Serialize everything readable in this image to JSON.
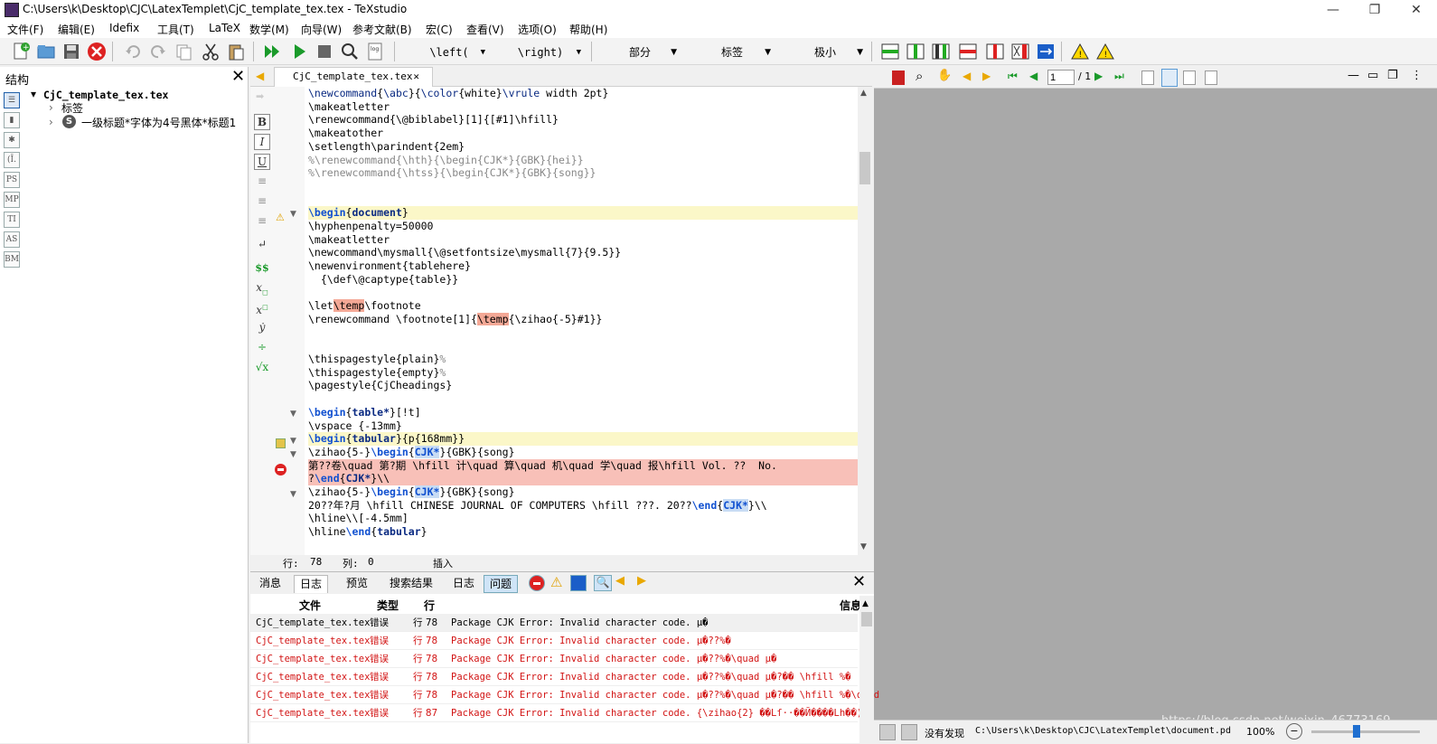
{
  "window": {
    "title": "C:\\Users\\k\\Desktop\\CJC\\LatexTemplet\\CjC_template_tex.tex - TeXstudio",
    "minimize": "—",
    "maximize": "❐",
    "close": "✕"
  },
  "menu": [
    "文件(F)",
    "编辑(E)",
    "Idefix",
    "工具(T)",
    "LaTeX",
    "数学(M)",
    "向导(W)",
    "参考文献(B)",
    "宏(C)",
    "查看(V)",
    "选项(O)",
    "帮助(H)"
  ],
  "toolbar": {
    "combo_left": "\\left(",
    "combo_right": "\\right)",
    "combo_section": "部分",
    "combo_label": "标签",
    "combo_size": "极小"
  },
  "structure": {
    "title": "结构",
    "close": "✕",
    "root": "CjC_template_tex.tex",
    "child1": "标签",
    "child2": "一级标题*字体为4号黑体*标题1",
    "side_icons": [
      "(Ī.",
      "PS",
      "MP",
      "TI",
      "AS",
      "BM"
    ]
  },
  "editor": {
    "tab_label": "CjC_template_tex.tex",
    "tab_close": "✕",
    "status_line": "行:",
    "status_line_val": "78",
    "status_col": "列:",
    "status_col_val": "0",
    "status_mode": "插入"
  },
  "code_lines": [
    "\\newcommand{\\abc}{\\color{white}\\vrule width 2pt}",
    "\\makeatletter",
    "\\renewcommand{\\@biblabel}[1]{[#1]\\hfill}",
    "\\makeatother",
    "\\setlength\\parindent{2em}",
    "%\\renewcommand{\\hth}{\\begin{CJK*}{GBK}{hei}}",
    "%\\renewcommand{\\htss}{\\begin{CJK*}{GBK}{song}}",
    "",
    "",
    "\\begin{document}",
    "\\hyphenpenalty=50000",
    "\\makeatletter",
    "\\newcommand\\mysmall{\\@setfontsize\\mysmall{7}{9.5}}",
    "\\newenvironment{tablehere}",
    "  {\\def\\@captype{table}}",
    "",
    "\\let\\temp\\footnote",
    "\\renewcommand \\footnote[1]{\\temp{\\zihao{-5}#1}}",
    "",
    "",
    "\\thispagestyle{plain}%",
    "\\thispagestyle{empty}%",
    "\\pagestyle{CjCheadings}",
    "",
    "\\begin{table*}[!t]",
    "\\vspace {-13mm}",
    "\\begin{tabular}{p{168mm}}",
    "\\zihao{5-}\\begin{CJK*}{GBK}{song}",
    "第??卷\\quad 第?期 \\hfill 计\\quad 算\\quad 机\\quad 学\\quad 报\\hfill Vol. ??  No.",
    "?\\end{CJK*}\\\\",
    "\\zihao{5-}\\begin{CJK*}{GBK}{song}",
    "20??年?月 \\hfill CHINESE JOURNAL OF COMPUTERS \\hfill ???. 20??\\end{CJK*}\\\\",
    "\\hline\\\\[-4.5mm]",
    "\\hline\\end{tabular}"
  ],
  "log": {
    "tabs": [
      "消息",
      "日志",
      "预览",
      "搜索结果"
    ],
    "subtabs": [
      "日志",
      "问题"
    ],
    "close": "✕",
    "columns": [
      "文件",
      "类型",
      "行",
      "信息"
    ],
    "rows": [
      {
        "file": "CjC_template_tex.tex",
        "type": "错误",
        "line": "行 78",
        "msg": "Package CJK Error: Invalid character code. µ�"
      },
      {
        "file": "CjC_template_tex.tex",
        "type": "错误",
        "line": "行 78",
        "msg": "Package CJK Error: Invalid character code. µ�??%�"
      },
      {
        "file": "CjC_template_tex.tex",
        "type": "错误",
        "line": "行 78",
        "msg": "Package CJK Error: Invalid character code. µ�??%�\\quad µ�"
      },
      {
        "file": "CjC_template_tex.tex",
        "type": "错误",
        "line": "行 78",
        "msg": "Package CJK Error: Invalid character code. µ�??%�\\quad µ�?�� \\hfill %�"
      },
      {
        "file": "CjC_template_tex.tex",
        "type": "错误",
        "line": "行 78",
        "msg": "Package CJK Error: Invalid character code. µ�??%�\\quad µ�?�� \\hfill %�\\quad"
      },
      {
        "file": "CjC_template_tex.tex",
        "type": "错误",
        "line": "行 87",
        "msg": "Package CJK Error: Invalid character code. {\\zihao{2} ��Lſ··��Й����Lh��)�"
      }
    ]
  },
  "pdf": {
    "page_input": "1",
    "page_total": "/ 1",
    "status_text": "没有发现",
    "status_path": "C:\\Users\\k\\Desktop\\CJC\\LatexTemplet\\document.pd",
    "zoom": "100%",
    "watermark": "https://blog.csdn.net/weixin_46773169"
  }
}
